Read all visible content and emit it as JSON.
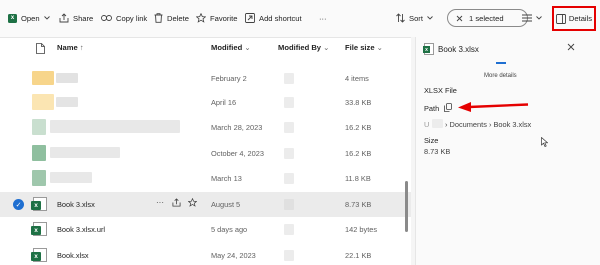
{
  "toolbar": {
    "open": "Open",
    "share": "Share",
    "copy_link": "Copy link",
    "delete": "Delete",
    "favorite": "Favorite",
    "add_shortcut": "Add shortcut",
    "more": "···",
    "sort": "Sort",
    "selection": "1 selected",
    "details": "Details"
  },
  "columns": {
    "name": "Name",
    "name_sort": "↑",
    "modified": "Modified",
    "modified_by": "Modified By",
    "file_size": "File size"
  },
  "rows": [
    {
      "name": "",
      "modified": "February 2",
      "size": "4 items"
    },
    {
      "name": "",
      "modified": "April 16",
      "size": "33.8 KB"
    },
    {
      "name": "",
      "modified": "March 28, 2023",
      "size": "16.2 KB"
    },
    {
      "name": "",
      "modified": "October 4, 2023",
      "size": "16.2 KB"
    },
    {
      "name": "",
      "modified": "March 13",
      "size": "11.8 KB"
    },
    {
      "name": "Book 3.xlsx",
      "modified": "August 5",
      "size": "8.73 KB"
    },
    {
      "name": "Book 3.xlsx.url",
      "modified": "5 days ago",
      "size": "142 bytes"
    },
    {
      "name": "Book.xlsx",
      "modified": "May 24, 2023",
      "size": "22.1 KB"
    }
  ],
  "details": {
    "title": "Book 3.xlsx",
    "more_details": "More details",
    "file_type": "XLSX File",
    "path_label": "Path",
    "path_value": "› Documents › Book 3.xlsx",
    "path_prefix": "U",
    "size_label": "Size",
    "size_value": "8.73 KB"
  },
  "colors": {
    "accent": "#1f6fd1",
    "highlight": "#e50000",
    "excel": "#1e7145"
  }
}
